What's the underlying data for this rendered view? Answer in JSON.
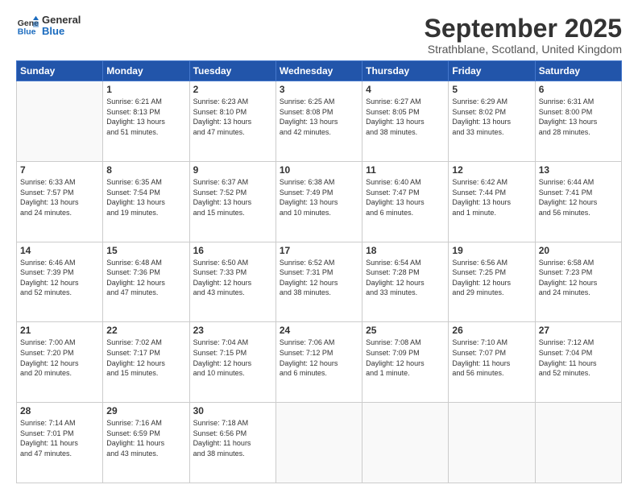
{
  "header": {
    "logo_line1": "General",
    "logo_line2": "Blue",
    "month_title": "September 2025",
    "location": "Strathblane, Scotland, United Kingdom"
  },
  "days_of_week": [
    "Sunday",
    "Monday",
    "Tuesday",
    "Wednesday",
    "Thursday",
    "Friday",
    "Saturday"
  ],
  "weeks": [
    [
      {
        "day": "",
        "info": ""
      },
      {
        "day": "1",
        "info": "Sunrise: 6:21 AM\nSunset: 8:13 PM\nDaylight: 13 hours\nand 51 minutes."
      },
      {
        "day": "2",
        "info": "Sunrise: 6:23 AM\nSunset: 8:10 PM\nDaylight: 13 hours\nand 47 minutes."
      },
      {
        "day": "3",
        "info": "Sunrise: 6:25 AM\nSunset: 8:08 PM\nDaylight: 13 hours\nand 42 minutes."
      },
      {
        "day": "4",
        "info": "Sunrise: 6:27 AM\nSunset: 8:05 PM\nDaylight: 13 hours\nand 38 minutes."
      },
      {
        "day": "5",
        "info": "Sunrise: 6:29 AM\nSunset: 8:02 PM\nDaylight: 13 hours\nand 33 minutes."
      },
      {
        "day": "6",
        "info": "Sunrise: 6:31 AM\nSunset: 8:00 PM\nDaylight: 13 hours\nand 28 minutes."
      }
    ],
    [
      {
        "day": "7",
        "info": "Sunrise: 6:33 AM\nSunset: 7:57 PM\nDaylight: 13 hours\nand 24 minutes."
      },
      {
        "day": "8",
        "info": "Sunrise: 6:35 AM\nSunset: 7:54 PM\nDaylight: 13 hours\nand 19 minutes."
      },
      {
        "day": "9",
        "info": "Sunrise: 6:37 AM\nSunset: 7:52 PM\nDaylight: 13 hours\nand 15 minutes."
      },
      {
        "day": "10",
        "info": "Sunrise: 6:38 AM\nSunset: 7:49 PM\nDaylight: 13 hours\nand 10 minutes."
      },
      {
        "day": "11",
        "info": "Sunrise: 6:40 AM\nSunset: 7:47 PM\nDaylight: 13 hours\nand 6 minutes."
      },
      {
        "day": "12",
        "info": "Sunrise: 6:42 AM\nSunset: 7:44 PM\nDaylight: 13 hours\nand 1 minute."
      },
      {
        "day": "13",
        "info": "Sunrise: 6:44 AM\nSunset: 7:41 PM\nDaylight: 12 hours\nand 56 minutes."
      }
    ],
    [
      {
        "day": "14",
        "info": "Sunrise: 6:46 AM\nSunset: 7:39 PM\nDaylight: 12 hours\nand 52 minutes."
      },
      {
        "day": "15",
        "info": "Sunrise: 6:48 AM\nSunset: 7:36 PM\nDaylight: 12 hours\nand 47 minutes."
      },
      {
        "day": "16",
        "info": "Sunrise: 6:50 AM\nSunset: 7:33 PM\nDaylight: 12 hours\nand 43 minutes."
      },
      {
        "day": "17",
        "info": "Sunrise: 6:52 AM\nSunset: 7:31 PM\nDaylight: 12 hours\nand 38 minutes."
      },
      {
        "day": "18",
        "info": "Sunrise: 6:54 AM\nSunset: 7:28 PM\nDaylight: 12 hours\nand 33 minutes."
      },
      {
        "day": "19",
        "info": "Sunrise: 6:56 AM\nSunset: 7:25 PM\nDaylight: 12 hours\nand 29 minutes."
      },
      {
        "day": "20",
        "info": "Sunrise: 6:58 AM\nSunset: 7:23 PM\nDaylight: 12 hours\nand 24 minutes."
      }
    ],
    [
      {
        "day": "21",
        "info": "Sunrise: 7:00 AM\nSunset: 7:20 PM\nDaylight: 12 hours\nand 20 minutes."
      },
      {
        "day": "22",
        "info": "Sunrise: 7:02 AM\nSunset: 7:17 PM\nDaylight: 12 hours\nand 15 minutes."
      },
      {
        "day": "23",
        "info": "Sunrise: 7:04 AM\nSunset: 7:15 PM\nDaylight: 12 hours\nand 10 minutes."
      },
      {
        "day": "24",
        "info": "Sunrise: 7:06 AM\nSunset: 7:12 PM\nDaylight: 12 hours\nand 6 minutes."
      },
      {
        "day": "25",
        "info": "Sunrise: 7:08 AM\nSunset: 7:09 PM\nDaylight: 12 hours\nand 1 minute."
      },
      {
        "day": "26",
        "info": "Sunrise: 7:10 AM\nSunset: 7:07 PM\nDaylight: 11 hours\nand 56 minutes."
      },
      {
        "day": "27",
        "info": "Sunrise: 7:12 AM\nSunset: 7:04 PM\nDaylight: 11 hours\nand 52 minutes."
      }
    ],
    [
      {
        "day": "28",
        "info": "Sunrise: 7:14 AM\nSunset: 7:01 PM\nDaylight: 11 hours\nand 47 minutes."
      },
      {
        "day": "29",
        "info": "Sunrise: 7:16 AM\nSunset: 6:59 PM\nDaylight: 11 hours\nand 43 minutes."
      },
      {
        "day": "30",
        "info": "Sunrise: 7:18 AM\nSunset: 6:56 PM\nDaylight: 11 hours\nand 38 minutes."
      },
      {
        "day": "",
        "info": ""
      },
      {
        "day": "",
        "info": ""
      },
      {
        "day": "",
        "info": ""
      },
      {
        "day": "",
        "info": ""
      }
    ]
  ]
}
